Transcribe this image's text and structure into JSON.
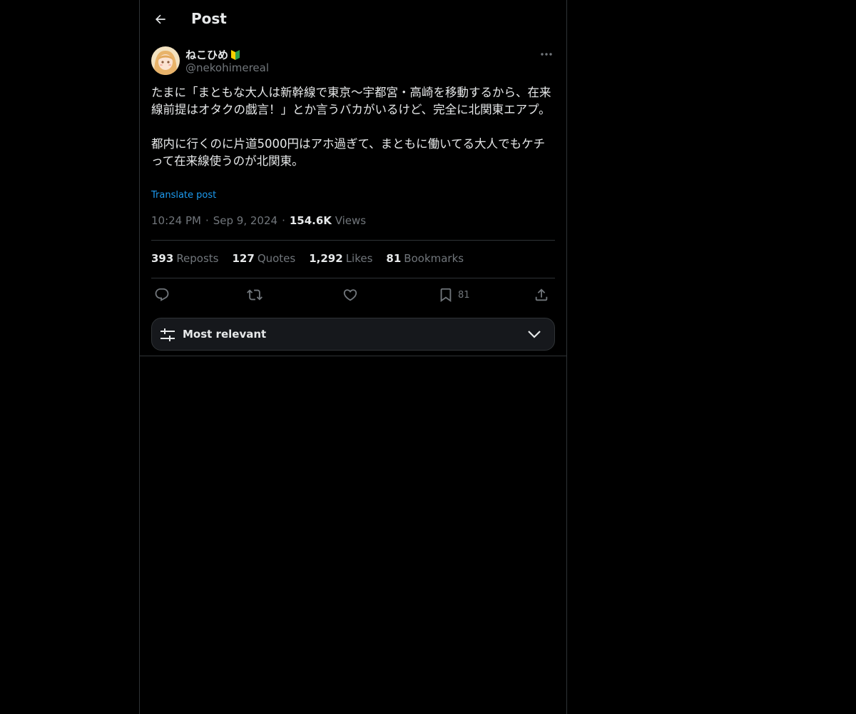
{
  "header": {
    "title": "Post",
    "back_icon": "arrow-left-icon"
  },
  "author": {
    "display_name": "ねこひめ",
    "badge": "🔰",
    "handle": "@nekohimereal",
    "avatar_icon": "avatar-image"
  },
  "post": {
    "paragraphs": [
      "たまに「まともな大人は新幹線で東京〜宇都宮・高崎を移動するから、在来線前提はオタクの戯言！」とか言うバカがいるけど、完全に北関東エアプ。",
      "都内に行くのに片道5000円はアホ過ぎて、まともに働いてる大人でもケチって在来線使うのが北関東。"
    ],
    "translate_label": "Translate post",
    "time": "10:24 PM",
    "date": "Sep 9, 2024",
    "views_count": "154.6K",
    "views_label": "Views",
    "separator": "·"
  },
  "stats": {
    "reposts": {
      "count": "393",
      "label": "Reposts"
    },
    "quotes": {
      "count": "127",
      "label": "Quotes"
    },
    "likes": {
      "count": "1,292",
      "label": "Likes"
    },
    "bookmarks": {
      "count": "81",
      "label": "Bookmarks"
    }
  },
  "actions": {
    "reply_icon": "reply-icon",
    "repost_icon": "repost-icon",
    "like_icon": "heart-icon",
    "bookmark_icon": "bookmark-icon",
    "bookmark_count": "81",
    "share_icon": "share-icon"
  },
  "replies_sort": {
    "label": "Most relevant",
    "icon": "sliders-icon",
    "chevron": "chevron-down-icon"
  },
  "colors": {
    "background": "#000000",
    "text": "#e7e9ea",
    "muted": "#71767b",
    "accent": "#1d9bf0",
    "border": "#2f3336"
  }
}
